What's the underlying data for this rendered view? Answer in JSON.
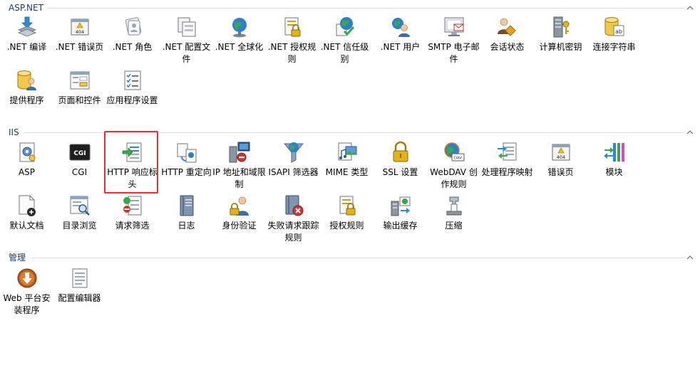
{
  "sections": [
    {
      "title": "ASP.NET",
      "items": [
        {
          "label": ".NET 编译",
          "icon": "download-gears-icon"
        },
        {
          "label": ".NET 错误页",
          "icon": "error-page-404-icon"
        },
        {
          "label": ".NET 角色",
          "icon": "roles-icon"
        },
        {
          "label": ".NET 配置文件",
          "icon": "profile-pages-icon"
        },
        {
          "label": ".NET 全球化",
          "icon": "globe-icon"
        },
        {
          "label": ".NET 授权规则",
          "icon": "document-lock-icon"
        },
        {
          "label": ".NET 信任级别",
          "icon": "globe-checkmark-icon"
        },
        {
          "label": ".NET 用户",
          "icon": "user-globe-icon"
        },
        {
          "label": "SMTP 电子邮件",
          "icon": "email-monitor-icon"
        },
        {
          "label": "会话状态",
          "icon": "session-users-icon"
        },
        {
          "label": "计算机密钥",
          "icon": "server-key-icon"
        },
        {
          "label": "连接字符串",
          "icon": "database-text-icon"
        },
        {
          "label": "提供程序",
          "icon": "database-user-icon"
        },
        {
          "label": "页面和控件",
          "icon": "page-controls-icon"
        },
        {
          "label": "应用程序设置",
          "icon": "checklist-icon"
        }
      ]
    },
    {
      "title": "IIS",
      "items": [
        {
          "label": "ASP",
          "icon": "asp-gear-icon"
        },
        {
          "label": "CGI",
          "icon": "cgi-icon"
        },
        {
          "label": "HTTP 响应标头",
          "icon": "response-headers-icon"
        },
        {
          "label": "HTTP 重定向",
          "icon": "redirect-icon"
        },
        {
          "label": "IP 地址和域限制",
          "icon": "ip-restriction-icon"
        },
        {
          "label": "ISAPI 筛选器",
          "icon": "funnel-globe-icon"
        },
        {
          "label": "MIME 类型",
          "icon": "mime-media-icon"
        },
        {
          "label": "SSL 设置",
          "icon": "padlock-icon"
        },
        {
          "label": "WebDAV 创作规则",
          "icon": "webdav-globe-icon"
        },
        {
          "label": "处理程序映射",
          "icon": "handler-mapping-icon"
        },
        {
          "label": "错误页",
          "icon": "error-page-404-icon"
        },
        {
          "label": "模块",
          "icon": "modules-icon"
        },
        {
          "label": "默认文档",
          "icon": "default-document-icon"
        },
        {
          "label": "目录浏览",
          "icon": "directory-browse-icon"
        },
        {
          "label": "请求筛选",
          "icon": "request-filter-icon"
        },
        {
          "label": "日志",
          "icon": "log-notebook-icon"
        },
        {
          "label": "身份验证",
          "icon": "authentication-user-icon"
        },
        {
          "label": "失败请求跟踪规则",
          "icon": "failed-request-icon"
        },
        {
          "label": "授权规则",
          "icon": "document-lock-icon"
        },
        {
          "label": "输出缓存",
          "icon": "output-cache-icon"
        },
        {
          "label": "压缩",
          "icon": "compression-clamp-icon"
        }
      ]
    },
    {
      "title": "管理",
      "items": [
        {
          "label": "Web 平台安装程序",
          "icon": "web-platform-installer-icon"
        },
        {
          "label": "配置编辑器",
          "icon": "config-editor-icon"
        }
      ]
    }
  ],
  "colors": {
    "section_title": "#1e3a5f",
    "divider": "#d6dde6",
    "highlight": "#e53030"
  }
}
